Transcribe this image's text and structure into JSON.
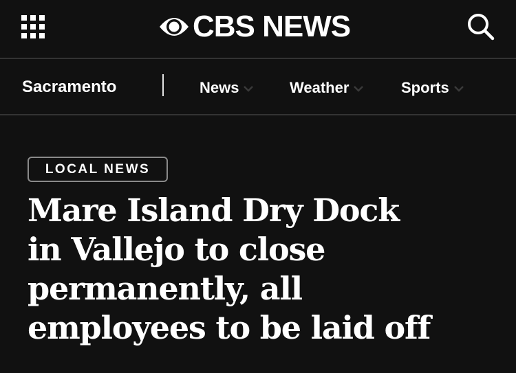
{
  "header": {
    "menu_icon": "grid-menu-icon",
    "logo_text": "CBS NEWS",
    "logo_icon": "cbs-eye-icon",
    "search_icon": "search-icon"
  },
  "nav": {
    "station": "Sacramento",
    "items": [
      {
        "label": "News",
        "icon": "chevron-down-icon"
      },
      {
        "label": "Weather",
        "icon": "chevron-down-icon"
      },
      {
        "label": "Sports",
        "icon": "chevron-down-icon"
      }
    ]
  },
  "article": {
    "category": "LOCAL NEWS",
    "headline_lines": [
      "Mare Island Dry Dock",
      "in Vallejo to close",
      "permanently, all",
      "employees to be laid off"
    ]
  },
  "colors": {
    "background": "#111111",
    "text": "#ffffff",
    "divider": "#333333",
    "badge_border": "#8a8a8a"
  }
}
